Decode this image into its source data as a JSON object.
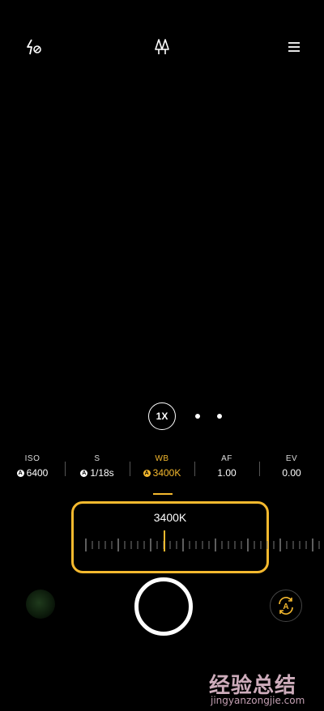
{
  "topbar": {
    "flash_icon": "flash-off-icon",
    "mode_icon": "tree-filter-icon",
    "menu_icon": "menu-icon"
  },
  "zoom": {
    "label": "1X",
    "extra_dots": 2
  },
  "params": [
    {
      "name": "ISO",
      "value": "6400",
      "auto": true,
      "active": false
    },
    {
      "name": "S",
      "value": "1/18s",
      "auto": true,
      "active": false
    },
    {
      "name": "WB",
      "value": "3400K",
      "auto": true,
      "active": true
    },
    {
      "name": "AF",
      "value": "1.00",
      "auto": false,
      "active": false
    },
    {
      "name": "EV",
      "value": "0.00",
      "auto": false,
      "active": false
    }
  ],
  "badge_letter": "A",
  "wb_panel": {
    "value": "3400K"
  },
  "controls": {
    "gallery_icon": "gallery-thumbnail",
    "shutter_icon": "shutter-icon",
    "auto_label": "A",
    "auto_icon": "auto-rotate-icon"
  },
  "colors": {
    "accent": "#f5b92e",
    "background": "#000000"
  },
  "watermark": {
    "cn": "经验总结",
    "en": "jingyanzongjie.com"
  }
}
